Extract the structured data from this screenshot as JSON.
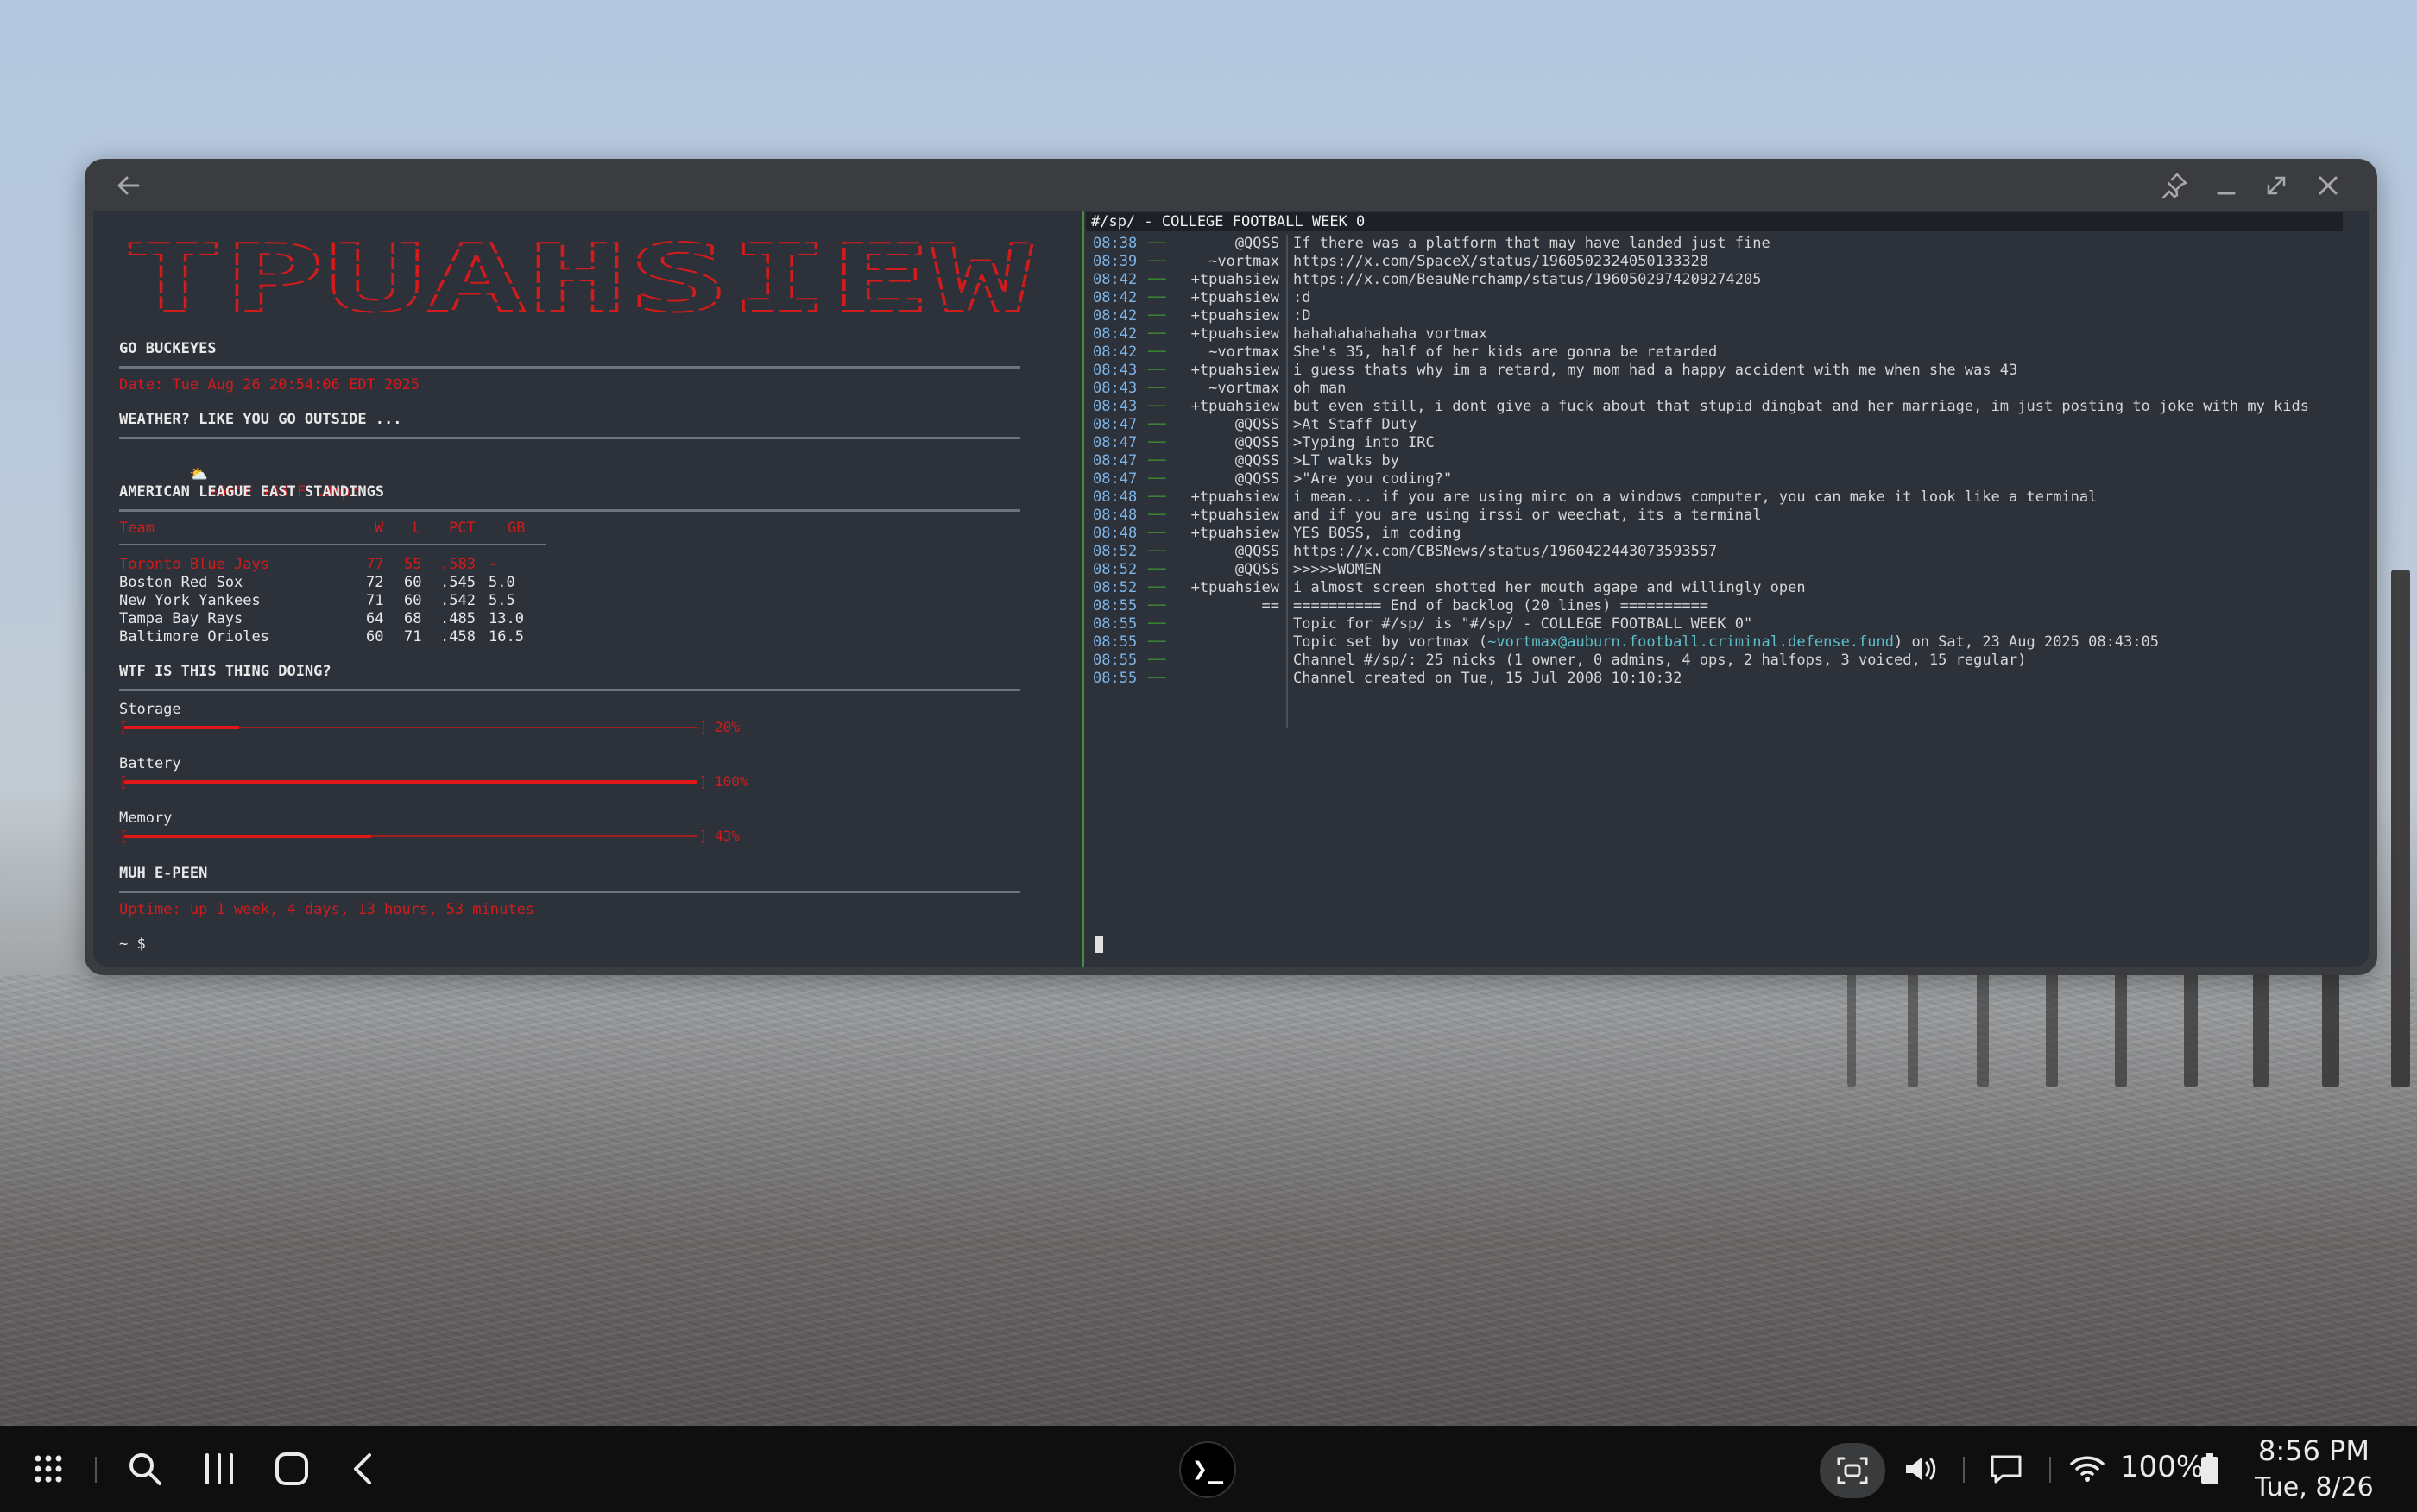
{
  "window": {
    "icons": [
      "back-arrow-icon",
      "pin-icon",
      "minimize-icon",
      "maximize-icon",
      "close-icon"
    ]
  },
  "left": {
    "banner": "TPUAHSIEW",
    "go_buckeyes": "GO BUCKEYES",
    "date_line": "Date: Tue Aug 26 20:54:06 EDT 2025",
    "weather_title": "WEATHER? LIKE YOU GO OUTSIDE ...",
    "weather_line": "+66°F +66°F ↘9mph",
    "standings_title": "AMERICAN LEAGUE EAST STANDINGS",
    "standings_header": {
      "team": "Team",
      "w": "W",
      "l": "L",
      "pct": "PCT",
      "gb": "GB"
    },
    "standings": [
      {
        "team": "Toronto Blue Jays",
        "w": "77",
        "l": "55",
        "pct": ".583",
        "gb": "-"
      },
      {
        "team": "Boston Red Sox",
        "w": "72",
        "l": "60",
        "pct": ".545",
        "gb": "5.0"
      },
      {
        "team": "New York Yankees",
        "w": "71",
        "l": "60",
        "pct": ".542",
        "gb": "5.5"
      },
      {
        "team": "Tampa Bay Rays",
        "w": "64",
        "l": "68",
        "pct": ".485",
        "gb": "13.0"
      },
      {
        "team": "Baltimore Orioles",
        "w": "60",
        "l": "71",
        "pct": ".458",
        "gb": "16.5"
      }
    ],
    "wtf_title": "WTF IS THIS THING DOING?",
    "progress": [
      {
        "label": "Storage",
        "pct_text": "20%",
        "value": 0.2
      },
      {
        "label": "Battery",
        "pct_text": "100%",
        "value": 1.0
      },
      {
        "label": "Memory",
        "pct_text": "43%",
        "value": 0.43
      }
    ],
    "epeen_title": "MUH E-PEEN",
    "uptime": "Uptime: up 1 week, 4 days, 13 hours, 53 minutes",
    "prompt": "~ $"
  },
  "irc": {
    "topic_bar": "#/sp/ - COLLEGE FOOTBALL WEEK 0",
    "lines": [
      {
        "ts": "08:38",
        "nick": "@QQSS",
        "msg": "If there was a platform that may have landed just fine"
      },
      {
        "ts": "08:39",
        "nick": "~vortmax",
        "msg": "https://x.com/SpaceX/status/1960502324050133328"
      },
      {
        "ts": "08:42",
        "nick": "+tpuahsiew",
        "msg": "https://x.com/BeauNerchamp/status/1960502974209274205"
      },
      {
        "ts": "08:42",
        "nick": "+tpuahsiew",
        "msg": ":d"
      },
      {
        "ts": "08:42",
        "nick": "+tpuahsiew",
        "msg": ":D"
      },
      {
        "ts": "08:42",
        "nick": "+tpuahsiew",
        "msg": "hahahahahahaha vortmax"
      },
      {
        "ts": "08:42",
        "nick": "~vortmax",
        "msg": "She's 35, half of her kids are gonna be retarded"
      },
      {
        "ts": "08:43",
        "nick": "+tpuahsiew",
        "msg": "i guess thats why im a retard, my mom had a happy accident with me when she was 43"
      },
      {
        "ts": "08:43",
        "nick": "~vortmax",
        "msg": "oh man"
      },
      {
        "ts": "08:43",
        "nick": "+tpuahsiew",
        "msg": "but even still, i dont give a fuck about that stupid dingbat and her marriage, im just posting to joke with my kids"
      },
      {
        "ts": "08:47",
        "nick": "@QQSS",
        "msg": ">At Staff Duty"
      },
      {
        "ts": "08:47",
        "nick": "@QQSS",
        "msg": ">Typing into IRC"
      },
      {
        "ts": "08:47",
        "nick": "@QQSS",
        "msg": ">LT walks by"
      },
      {
        "ts": "08:47",
        "nick": "@QQSS",
        "msg": ">\"Are you coding?\""
      },
      {
        "ts": "08:48",
        "nick": "+tpuahsiew",
        "msg": "i mean... if you are using mirc on a windows computer, you can make it look like a terminal"
      },
      {
        "ts": "08:48",
        "nick": "+tpuahsiew",
        "msg": "and if you are using irssi or weechat, its a terminal"
      },
      {
        "ts": "08:48",
        "nick": "+tpuahsiew",
        "msg": "YES BOSS, im coding"
      },
      {
        "ts": "08:52",
        "nick": "@QQSS",
        "msg": "https://x.com/CBSNews/status/1960422443073593557"
      },
      {
        "ts": "08:52",
        "nick": "@QQSS",
        "msg": ">>>>>WOMEN"
      },
      {
        "ts": "08:52",
        "nick": "+tpuahsiew",
        "msg": "i almost screen shotted her mouth agape and willingly open"
      },
      {
        "ts": "08:55",
        "nick": "==",
        "msg": "========== End of backlog (20 lines) =========="
      },
      {
        "ts": "08:55",
        "nick": "",
        "msg": "Topic for #/sp/ is \"#/sp/ - COLLEGE FOOTBALL WEEK 0\""
      },
      {
        "ts": "08:55",
        "nick": "",
        "msg_pre": "Topic set by vortmax (",
        "msg_hl": "~vortmax@auburn.football.criminal.defense.fund",
        "msg_post": ") on Sat, 23 Aug 2025 08:43:05"
      },
      {
        "ts": "08:55",
        "nick": "",
        "msg": "Channel #/sp/: 25 nicks (1 owner, 0 admins, 4 ops, 2 halfops, 3 voiced, 15 regular)"
      },
      {
        "ts": "08:55",
        "nick": "",
        "msg": "Channel created on Tue, 15 Jul 2008 10:10:32"
      }
    ]
  },
  "taskbar": {
    "left_icons": [
      "app-grid-icon",
      "search-icon",
      "recents-icon",
      "home-icon",
      "back-icon"
    ],
    "center_app": "terminal-icon",
    "terminal_glyph": "❯_",
    "right_icons": [
      "screenshot-icon",
      "volume-icon",
      "notifications-icon",
      "wifi-icon",
      "battery-icon"
    ],
    "battery": "100%",
    "time": "8:56 PM",
    "date": "Tue, 8/26"
  },
  "colors": {
    "terminal_bg": "#2c313a",
    "accent_red": "#d11c1c",
    "timestamp_blue": "#7fb4e6",
    "divider_green": "#4a8a3c"
  }
}
